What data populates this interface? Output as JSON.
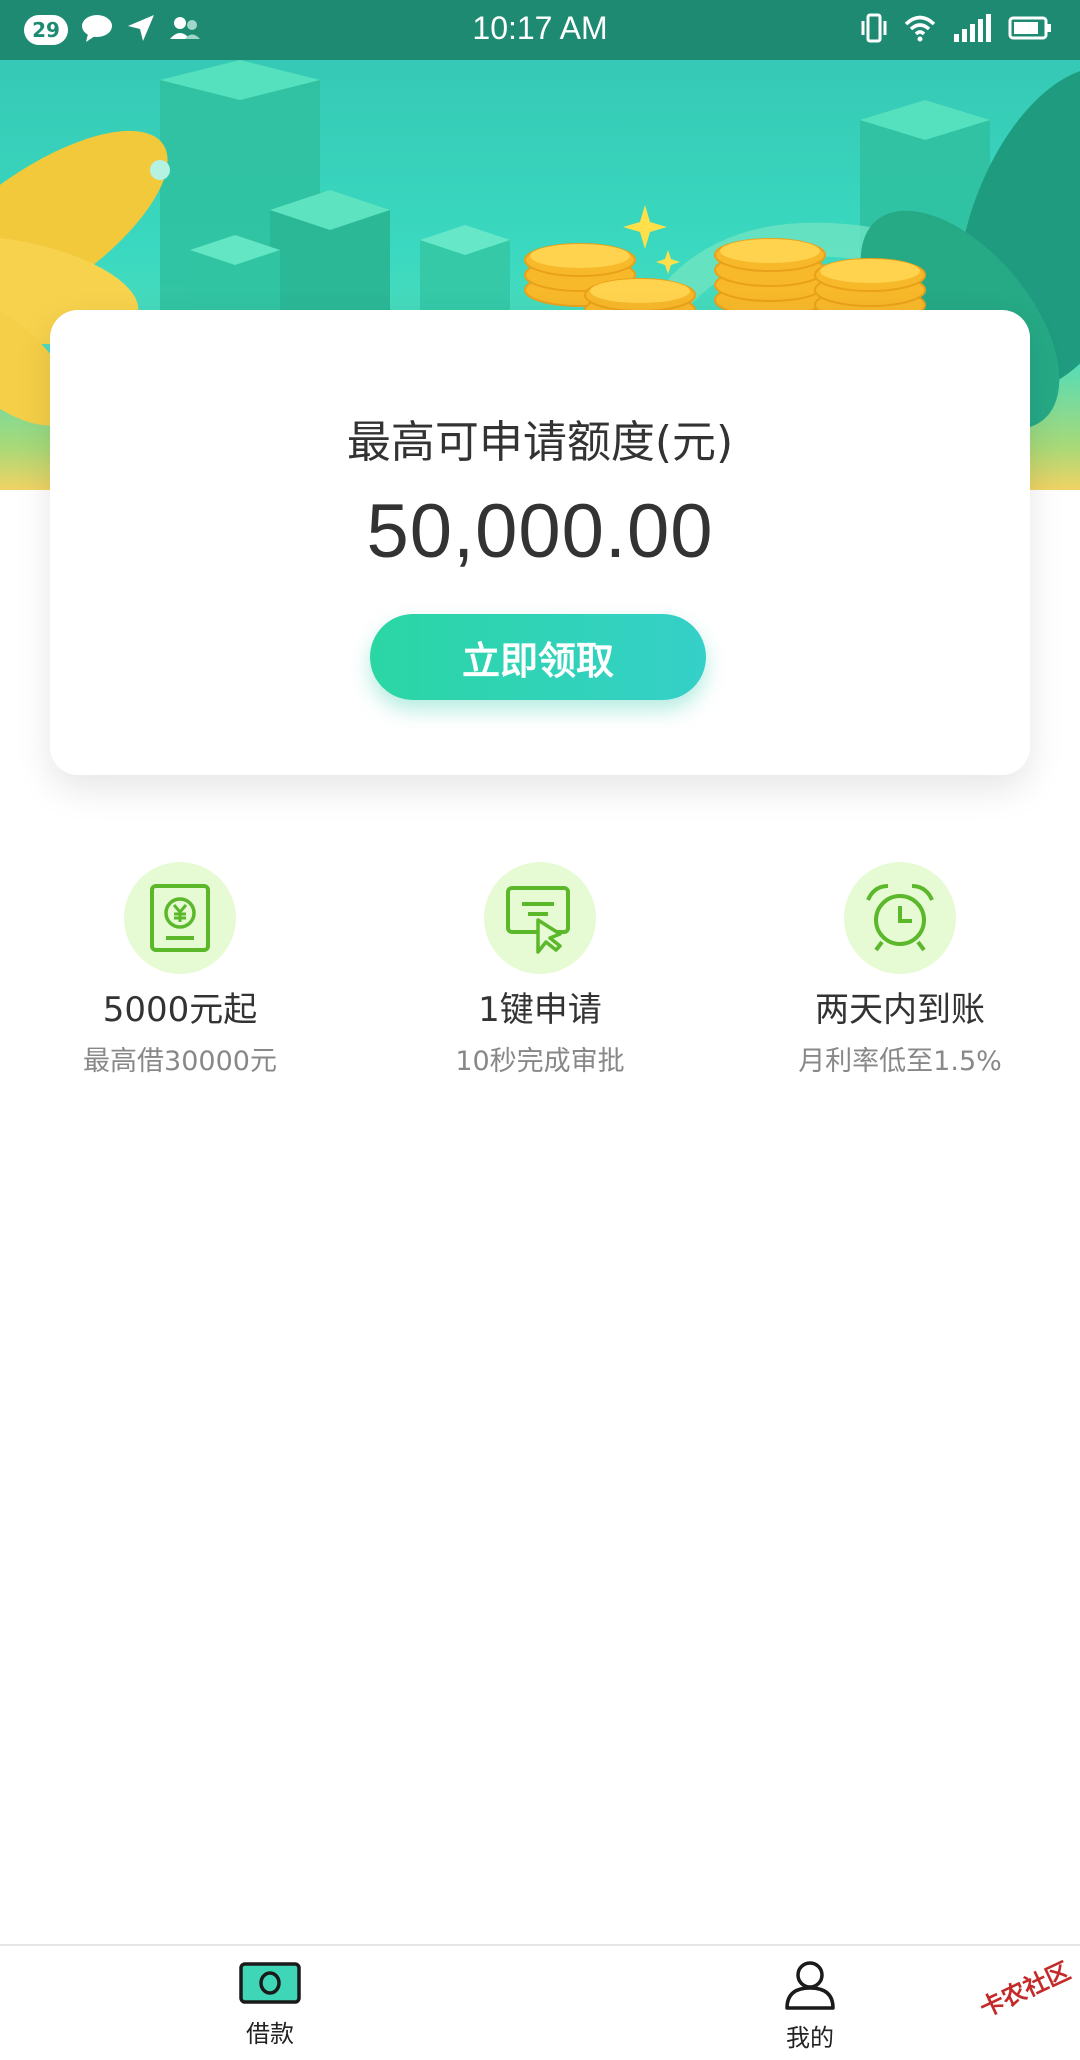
{
  "status_bar": {
    "notification_count": "29",
    "time": "10:17 AM"
  },
  "card": {
    "title": "最高可申请额度(元)",
    "amount": "50,000.00",
    "button_label": "立即领取"
  },
  "features": [
    {
      "icon": "money-document-icon",
      "title": "5000元起",
      "subtitle": "最高借30000元"
    },
    {
      "icon": "click-apply-icon",
      "title": "1键申请",
      "subtitle": "10秒完成审批"
    },
    {
      "icon": "alarm-clock-icon",
      "title": "两天内到账",
      "subtitle": "月利率低至1.5%"
    }
  ],
  "bottom_nav": {
    "items": [
      {
        "label": "借款",
        "icon": "cash-icon",
        "active": true
      },
      {
        "label": "我的",
        "icon": "user-icon",
        "active": false
      }
    ]
  },
  "watermark": "卡农社区",
  "colors": {
    "accent": "#2bd6a4",
    "status_bar": "#1f8a72",
    "feature_icon_bg": "#e6fbd4",
    "feature_icon_stroke": "#5bb82b"
  }
}
